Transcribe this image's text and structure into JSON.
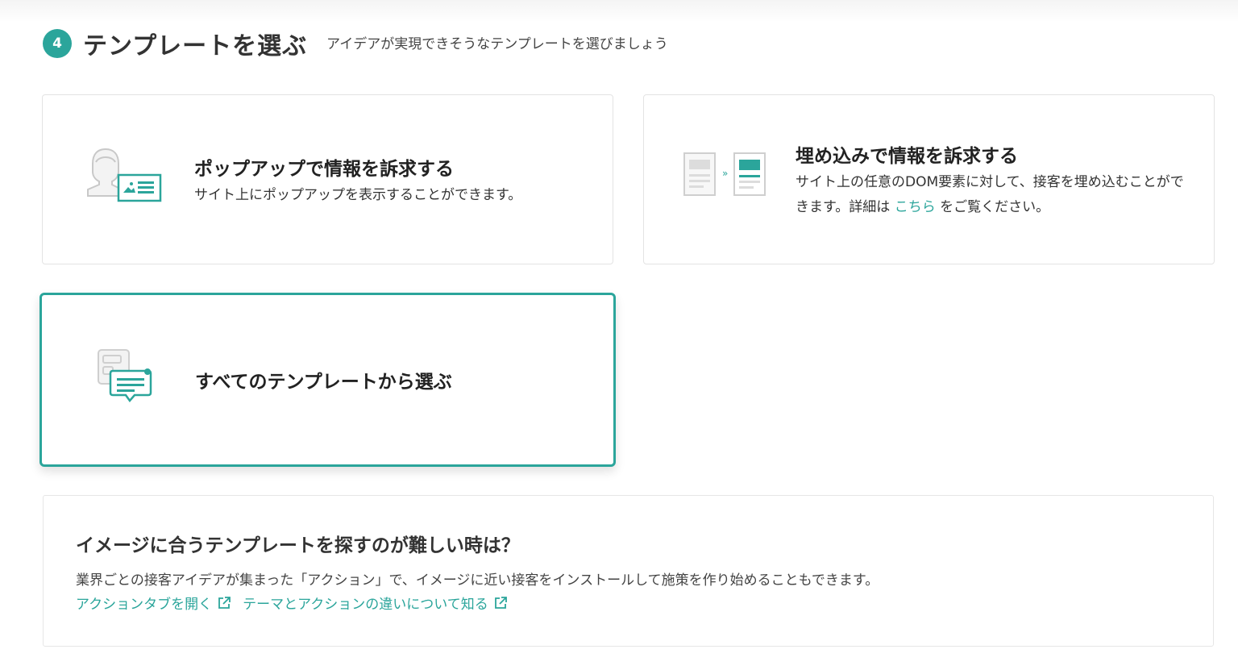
{
  "step": {
    "number": "4",
    "title": "テンプレートを選ぶ",
    "subtitle": "アイデアが実現できそうなテンプレートを選びましょう"
  },
  "cards": [
    {
      "title": "ポップアップで情報を訴求する",
      "description": "サイト上にポップアップを表示することができます。",
      "icon": "popup-person-icon"
    },
    {
      "title": "埋め込みで情報を訴求する",
      "description_before": "サイト上の任意のDOM要素に対して、接客を埋め込むことができます。詳細は",
      "description_link": "こちら",
      "description_after": "をご覧ください。",
      "icon": "embed-pages-icon"
    },
    {
      "title": "すべてのテンプレートから選ぶ",
      "icon": "template-chat-icon",
      "selected": true
    }
  ],
  "help": {
    "title": "イメージに合うテンプレートを探すのが難しい時は？",
    "description": "業界ごとの接客アイデアが集まった「アクション」で、イメージに近い接客をインストールして施策を作り始めることもできます。",
    "links": [
      {
        "label": "アクションタブを開く",
        "icon": "external-link-icon"
      },
      {
        "label": "テーマとアクションの違いについて知る",
        "icon": "external-link-icon"
      }
    ]
  },
  "colors": {
    "accent": "#2ba59b",
    "border": "#e3e3e3",
    "text": "#333333"
  }
}
